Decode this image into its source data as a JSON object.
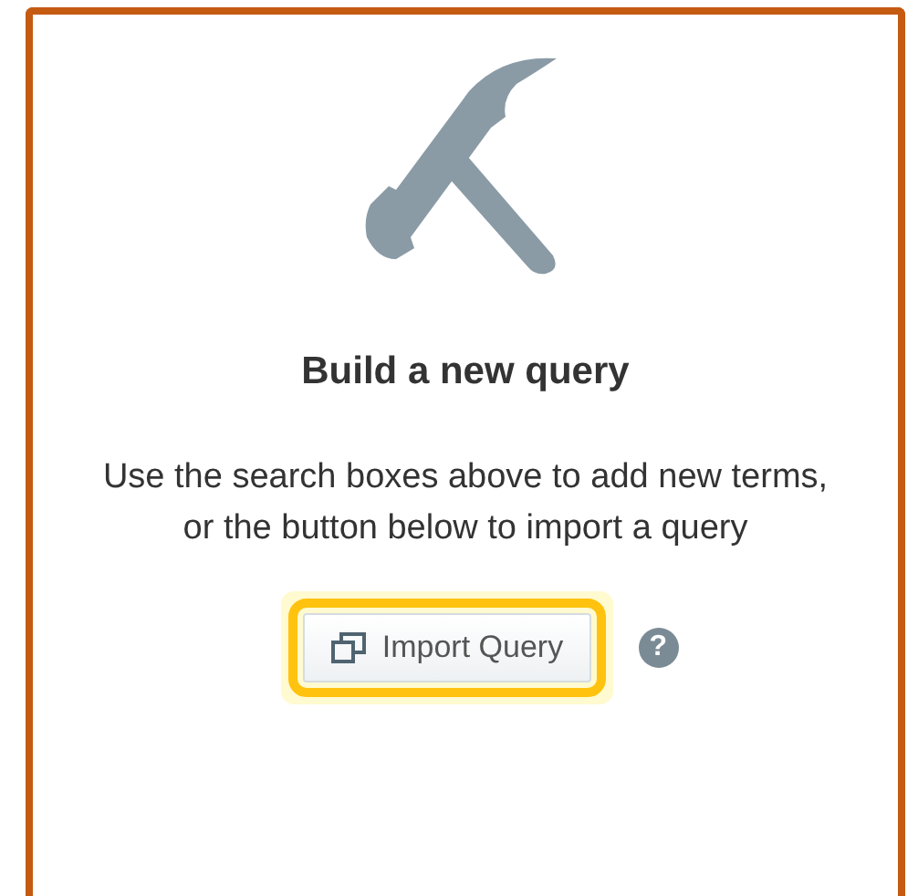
{
  "title": "Build a new query",
  "description": "Use the search boxes above to add new terms, or the button below to import a query",
  "import_button": {
    "label": "Import Query",
    "highlighted": true
  },
  "help": {
    "label": "?"
  }
}
